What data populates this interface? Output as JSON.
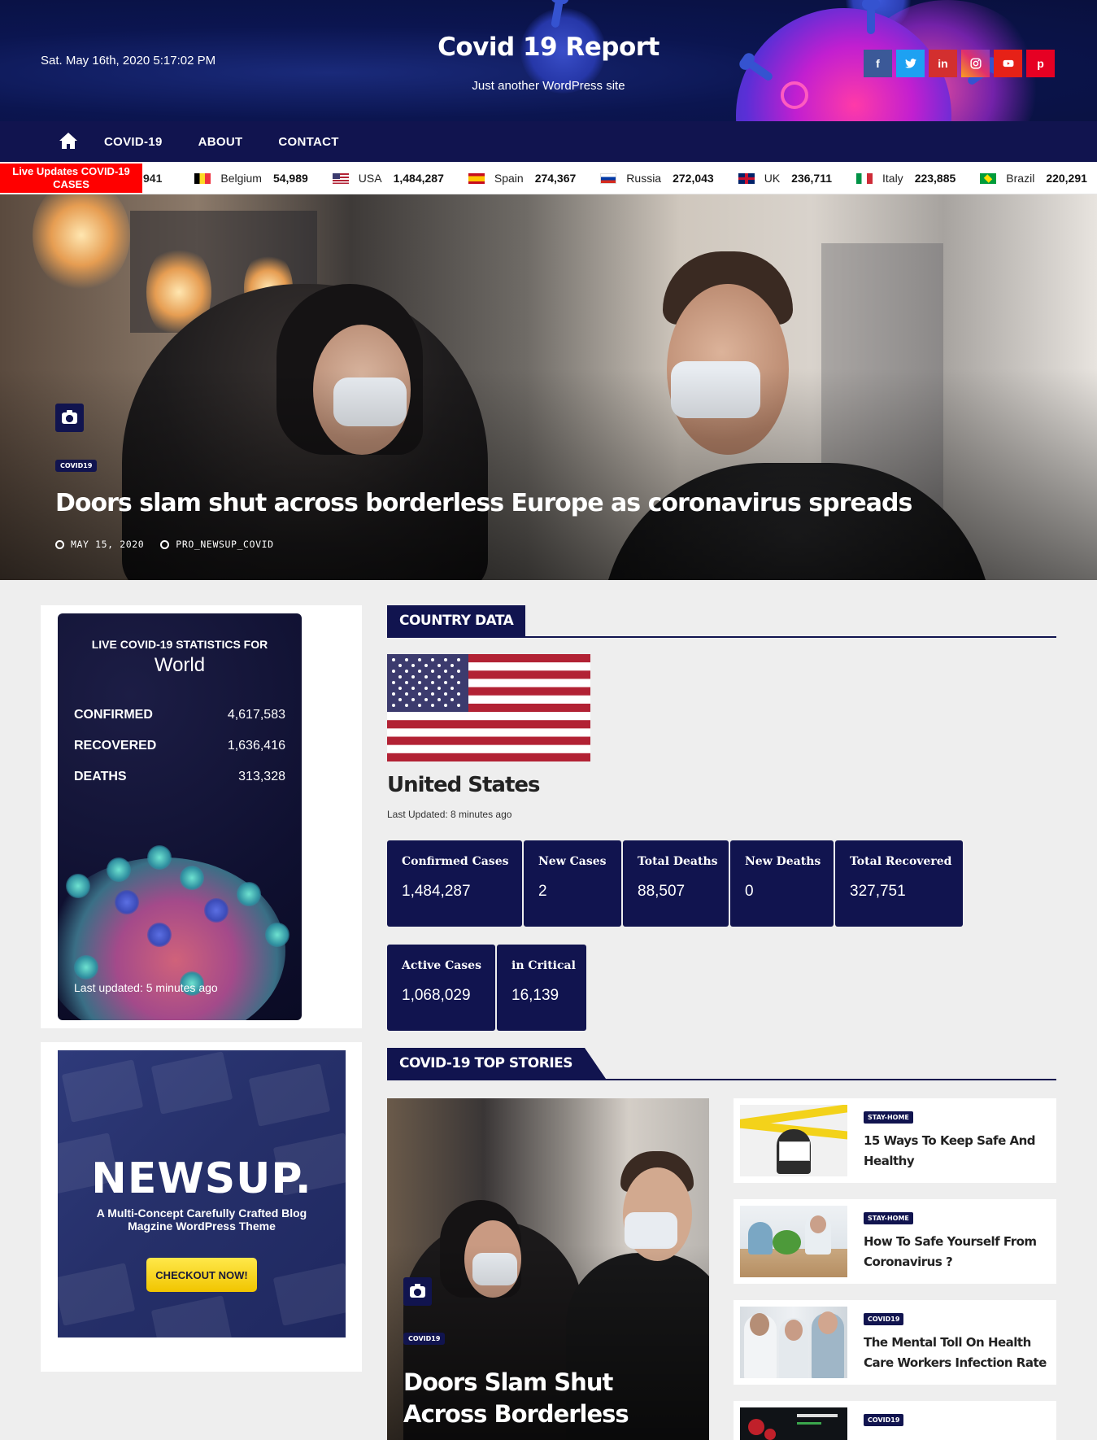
{
  "header": {
    "date_time": "Sat. May 16th, 2020 5:17:02 PM",
    "site_title": "Covid 19 Report",
    "tagline": "Just another WordPress site",
    "socials": [
      {
        "name": "facebook",
        "glyph": "f",
        "color": "#3b5998"
      },
      {
        "name": "twitter",
        "glyph": "t",
        "color": "#1da1f2"
      },
      {
        "name": "linkedin",
        "glyph": "in",
        "color": "#d32f2f"
      },
      {
        "name": "instagram",
        "glyph": "◎",
        "color": "#e1306c"
      },
      {
        "name": "youtube",
        "glyph": "▶",
        "color": "#e62117"
      },
      {
        "name": "pinterest",
        "glyph": "p",
        "color": "#e60023"
      }
    ]
  },
  "nav": {
    "items": [
      "COVID-19",
      "ABOUT",
      "CONTACT"
    ]
  },
  "ticker": {
    "label": "Live Updates COVID-19 CASES",
    "first_value": "941",
    "items": [
      {
        "country": "Belgium",
        "value": "54,989"
      },
      {
        "country": "USA",
        "value": "1,484,287"
      },
      {
        "country": "Spain",
        "value": "274,367"
      },
      {
        "country": "Russia",
        "value": "272,043"
      },
      {
        "country": "UK",
        "value": "236,711"
      },
      {
        "country": "Italy",
        "value": "223,885"
      },
      {
        "country": "Brazil",
        "value": "220,291"
      }
    ]
  },
  "hero": {
    "category": "COVID19",
    "title": "Doors slam shut across borderless Europe as coronavirus spreads",
    "date": "MAY 15, 2020",
    "author": "PRO_NEWSUP_COVID"
  },
  "stats_widget": {
    "heading": "LIVE COVID-19 STATISTICS FOR",
    "location": "World",
    "rows": [
      {
        "label": "CONFIRMED",
        "value": "4,617,583"
      },
      {
        "label": "RECOVERED",
        "value": "1,636,416"
      },
      {
        "label": "DEATHS",
        "value": "313,328"
      }
    ],
    "updated": "Last updated: 5 minutes ago"
  },
  "ad": {
    "logo": "NEWSUP.",
    "subtitle": "A Multi-Concept Carefully Crafted Blog Magzine WordPress Theme",
    "button": "CHECKOUT NOW!"
  },
  "country_data": {
    "section_title": "COUNTRY DATA",
    "country": "United States",
    "updated": "Last Updated: 8 minutes ago",
    "cards": [
      {
        "label": "Confirmed Cases",
        "value": "1,484,287"
      },
      {
        "label": "New Cases",
        "value": "2"
      },
      {
        "label": "Total Deaths",
        "value": "88,507"
      },
      {
        "label": "New Deaths",
        "value": "0"
      },
      {
        "label": "Total Recovered",
        "value": "327,751"
      },
      {
        "label": "Active Cases",
        "value": "1,068,029"
      },
      {
        "label": "in Critical",
        "value": "16,139"
      }
    ]
  },
  "top_stories": {
    "section_title": "COVID-19 TOP STORIES",
    "featured": {
      "category": "COVID19",
      "title": "Doors Slam Shut Across Borderless"
    },
    "list": [
      {
        "category": "STAY-HOME",
        "title": "15 Ways To Keep Safe And Healthy"
      },
      {
        "category": "STAY-HOME",
        "title": "How To Safe Yourself From Coronavirus ?"
      },
      {
        "category": "COVID19",
        "title": "The Mental Toll On Health Care Workers Infection Rate"
      },
      {
        "category": "COVID19",
        "title": ""
      }
    ]
  }
}
